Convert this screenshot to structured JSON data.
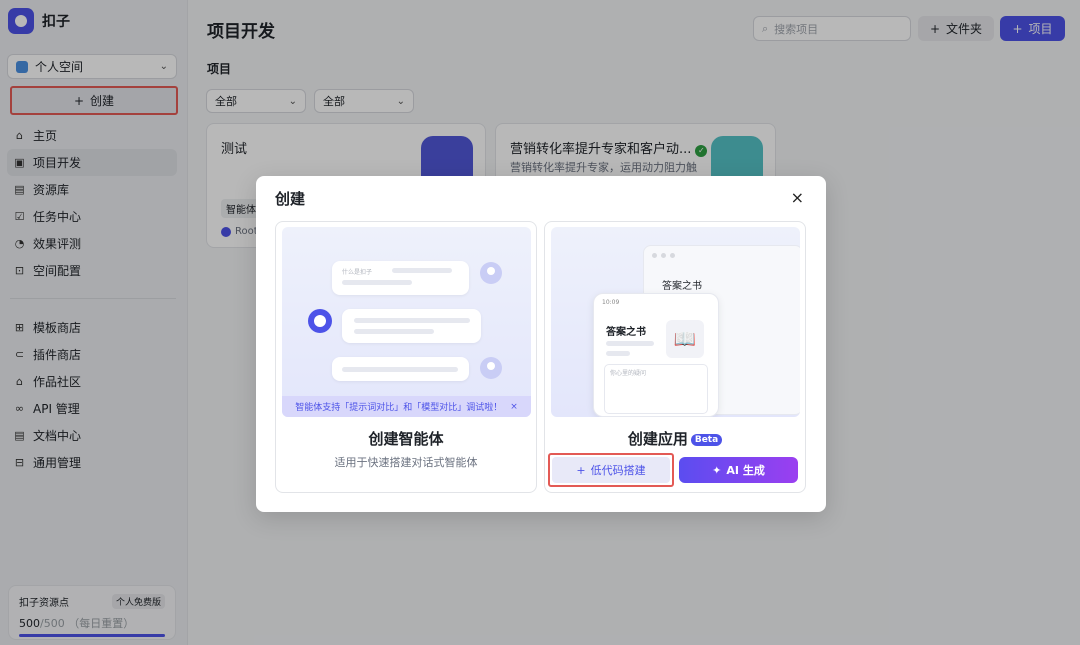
{
  "brand": {
    "name": "扣子"
  },
  "sidebar": {
    "space_label": "个人空间",
    "create_label": "创建",
    "nav_primary": [
      {
        "label": "主页",
        "icon": "home-icon",
        "glyph": "⌂"
      },
      {
        "label": "项目开发",
        "icon": "project-dev-icon",
        "glyph": "▣",
        "active": true
      },
      {
        "label": "资源库",
        "icon": "library-icon",
        "glyph": "▤"
      },
      {
        "label": "任务中心",
        "icon": "task-icon",
        "glyph": "☑"
      },
      {
        "label": "效果评测",
        "icon": "evaluation-icon",
        "glyph": "◔"
      },
      {
        "label": "空间配置",
        "icon": "space-config-icon",
        "glyph": "⊡"
      }
    ],
    "nav_secondary": [
      {
        "label": "模板商店",
        "icon": "template-store-icon",
        "glyph": "⊞"
      },
      {
        "label": "插件商店",
        "icon": "plugin-store-icon",
        "glyph": "⊂"
      },
      {
        "label": "作品社区",
        "icon": "community-icon",
        "glyph": "⌂"
      },
      {
        "label": "API 管理",
        "icon": "api-icon",
        "glyph": "∞"
      },
      {
        "label": "文档中心",
        "icon": "docs-icon",
        "glyph": "▤"
      },
      {
        "label": "通用管理",
        "icon": "settings-icon",
        "glyph": "⊟"
      }
    ],
    "quota": {
      "title": "扣子资源点",
      "badge": "个人免费版",
      "used": "500",
      "total": "/500",
      "note": "（每日重置）",
      "fraction": 1.0
    }
  },
  "header": {
    "title": "项目开发",
    "search_placeholder": "搜索项目",
    "folder_label": "文件夹",
    "project_label": "项目"
  },
  "main": {
    "section_label": "项目",
    "filters": [
      "全部",
      "全部"
    ],
    "cards": [
      {
        "title": "测试",
        "desc": "",
        "tag": "智能体",
        "owner": "Root"
      },
      {
        "title": "营销转化率提升专家和客户动...",
        "desc": "营销转化率提升专家，运用动力阻力触",
        "tag": "",
        "owner": ""
      }
    ]
  },
  "dialog": {
    "title": "创建",
    "close_glyph": "×",
    "agent": {
      "title": "创建智能体",
      "subtitle": "适用于快速搭建对话式智能体",
      "bubble_hint": "什么是扣子",
      "banner": "智能体支持「提示词对比」和「模型对比」调试啦！",
      "banner_close": "×"
    },
    "app": {
      "title": "创建应用",
      "badge": "Beta",
      "back_title": "答案之书",
      "phone_time": "10:09",
      "phone_title": "答案之书",
      "phone_input_hint": "你心里的疑问",
      "lowcode_label": "低代码搭建",
      "ai_label": "AI 生成"
    }
  },
  "colors": {
    "accent": "#4d53e8",
    "highlight": "#e35a55"
  }
}
